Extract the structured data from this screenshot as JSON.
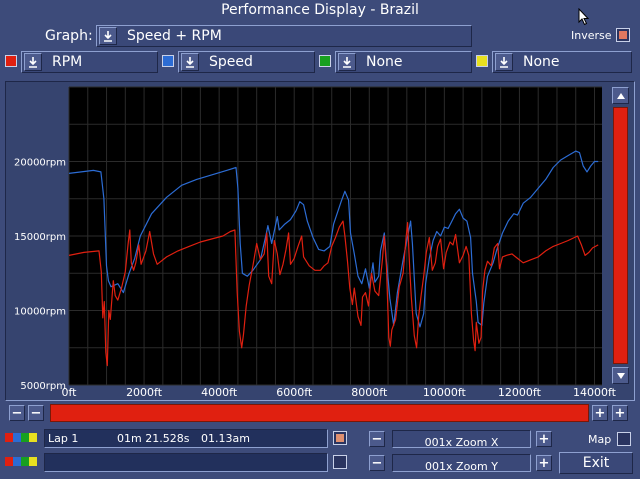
{
  "window": {
    "title": "Performance Display - Brazil"
  },
  "graph": {
    "label": "Graph:",
    "selected": "Speed + RPM"
  },
  "inverse": {
    "label": "Inverse"
  },
  "channels": [
    {
      "color": "#e02010",
      "name": "RPM"
    },
    {
      "color": "#2c6cd4",
      "name": "Speed"
    },
    {
      "color": "#18a020",
      "name": "None"
    },
    {
      "color": "#e8e020",
      "name": "None"
    }
  ],
  "icons": {
    "dropdown": "download-arrow-icon",
    "scroll_up": "up-arrow-icon",
    "scroll_down": "down-arrow-icon",
    "minus": "minus-icon",
    "plus": "plus-icon",
    "cursor": "mouse-pointer-icon"
  },
  "chart_data": {
    "type": "line",
    "xlabel": "",
    "ylabel": "",
    "xlim": [
      0,
      14200
    ],
    "ylim": [
      5000,
      25000
    ],
    "x_ticks": [
      {
        "v": 0,
        "label": "0ft"
      },
      {
        "v": 2000,
        "label": "2000ft"
      },
      {
        "v": 4000,
        "label": "4000ft"
      },
      {
        "v": 6000,
        "label": "6000ft"
      },
      {
        "v": 8000,
        "label": "8000ft"
      },
      {
        "v": 10000,
        "label": "10000ft"
      },
      {
        "v": 12000,
        "label": "12000ft"
      },
      {
        "v": 14000,
        "label": "14000ft"
      }
    ],
    "y_ticks": [
      {
        "v": 5000,
        "label": "5000rpm"
      },
      {
        "v": 10000,
        "label": "10000rpm"
      },
      {
        "v": 15000,
        "label": "15000rpm"
      },
      {
        "v": 20000,
        "label": "20000rpm"
      }
    ],
    "grid": true,
    "series": [
      {
        "color": "#2c6cd4",
        "points": [
          [
            0,
            19200
          ],
          [
            650,
            19400
          ],
          [
            850,
            19300
          ],
          [
            930,
            17500
          ],
          [
            1000,
            13000
          ],
          [
            1050,
            12000
          ],
          [
            1120,
            11600
          ],
          [
            1300,
            11800
          ],
          [
            1450,
            11200
          ],
          [
            1600,
            12500
          ],
          [
            1750,
            13500
          ],
          [
            1900,
            15000
          ],
          [
            2200,
            16500
          ],
          [
            2600,
            17600
          ],
          [
            3000,
            18400
          ],
          [
            3400,
            18800
          ],
          [
            3800,
            19100
          ],
          [
            4200,
            19400
          ],
          [
            4450,
            19600
          ],
          [
            4500,
            18200
          ],
          [
            4560,
            14500
          ],
          [
            4620,
            12500
          ],
          [
            4750,
            12300
          ],
          [
            4900,
            12700
          ],
          [
            5100,
            13400
          ],
          [
            5250,
            15100
          ],
          [
            5300,
            15700
          ],
          [
            5400,
            14500
          ],
          [
            5550,
            16300
          ],
          [
            5600,
            15400
          ],
          [
            5750,
            15800
          ],
          [
            5900,
            16100
          ],
          [
            6050,
            16700
          ],
          [
            6150,
            17300
          ],
          [
            6250,
            17100
          ],
          [
            6350,
            16000
          ],
          [
            6500,
            14900
          ],
          [
            6650,
            14100
          ],
          [
            6800,
            14000
          ],
          [
            6950,
            14300
          ],
          [
            7050,
            15800
          ],
          [
            7250,
            17300
          ],
          [
            7350,
            18000
          ],
          [
            7450,
            17400
          ],
          [
            7500,
            15200
          ],
          [
            7600,
            13800
          ],
          [
            7700,
            12300
          ],
          [
            7800,
            11800
          ],
          [
            7900,
            12800
          ],
          [
            8000,
            11500
          ],
          [
            8100,
            13200
          ],
          [
            8150,
            11900
          ],
          [
            8250,
            12300
          ],
          [
            8300,
            14000
          ],
          [
            8400,
            15200
          ],
          [
            8450,
            13500
          ],
          [
            8550,
            10800
          ],
          [
            8650,
            9000
          ],
          [
            8750,
            11200
          ],
          [
            8900,
            13400
          ],
          [
            9000,
            14700
          ],
          [
            9100,
            16000
          ],
          [
            9150,
            14500
          ],
          [
            9250,
            9800
          ],
          [
            9350,
            8900
          ],
          [
            9450,
            9800
          ],
          [
            9500,
            11800
          ],
          [
            9600,
            13500
          ],
          [
            9700,
            14700
          ],
          [
            9800,
            15300
          ],
          [
            9900,
            15000
          ],
          [
            10000,
            15600
          ],
          [
            10100,
            15500
          ],
          [
            10200,
            16000
          ],
          [
            10300,
            16500
          ],
          [
            10400,
            16800
          ],
          [
            10500,
            16200
          ],
          [
            10600,
            16000
          ],
          [
            10700,
            14900
          ],
          [
            10750,
            12500
          ],
          [
            10850,
            10600
          ],
          [
            10900,
            9200
          ],
          [
            11000,
            9000
          ],
          [
            11050,
            10500
          ],
          [
            11150,
            12300
          ],
          [
            11300,
            13200
          ],
          [
            11400,
            14100
          ],
          [
            11550,
            15200
          ],
          [
            11700,
            16000
          ],
          [
            11850,
            16500
          ],
          [
            11950,
            16400
          ],
          [
            12100,
            17200
          ],
          [
            12300,
            17600
          ],
          [
            12500,
            18200
          ],
          [
            12700,
            18800
          ],
          [
            12900,
            19600
          ],
          [
            13100,
            20100
          ],
          [
            13300,
            20400
          ],
          [
            13500,
            20700
          ],
          [
            13600,
            20600
          ],
          [
            13700,
            19700
          ],
          [
            13800,
            19300
          ],
          [
            13900,
            19700
          ],
          [
            14000,
            20000
          ],
          [
            14100,
            20000
          ]
        ]
      },
      {
        "color": "#e02010",
        "points": [
          [
            0,
            13700
          ],
          [
            400,
            13900
          ],
          [
            800,
            14000
          ],
          [
            860,
            12600
          ],
          [
            900,
            9500
          ],
          [
            940,
            10600
          ],
          [
            980,
            7200
          ],
          [
            1020,
            6300
          ],
          [
            1060,
            10000
          ],
          [
            1100,
            9400
          ],
          [
            1180,
            12000
          ],
          [
            1230,
            11000
          ],
          [
            1300,
            10700
          ],
          [
            1400,
            11500
          ],
          [
            1500,
            12600
          ],
          [
            1580,
            14600
          ],
          [
            1620,
            15400
          ],
          [
            1660,
            13200
          ],
          [
            1720,
            12700
          ],
          [
            1780,
            13200
          ],
          [
            1860,
            14400
          ],
          [
            1920,
            13100
          ],
          [
            2050,
            14000
          ],
          [
            2150,
            15300
          ],
          [
            2250,
            13800
          ],
          [
            2350,
            13100
          ],
          [
            2600,
            13600
          ],
          [
            2900,
            14000
          ],
          [
            3200,
            14300
          ],
          [
            3500,
            14600
          ],
          [
            3800,
            14800
          ],
          [
            4100,
            15000
          ],
          [
            4300,
            15300
          ],
          [
            4420,
            15400
          ],
          [
            4480,
            11200
          ],
          [
            4540,
            8600
          ],
          [
            4600,
            7500
          ],
          [
            4650,
            8400
          ],
          [
            4720,
            10300
          ],
          [
            4800,
            11700
          ],
          [
            4900,
            13000
          ],
          [
            5000,
            14500
          ],
          [
            5100,
            13400
          ],
          [
            5200,
            13800
          ],
          [
            5270,
            15200
          ],
          [
            5320,
            12300
          ],
          [
            5400,
            11800
          ],
          [
            5470,
            14700
          ],
          [
            5550,
            13800
          ],
          [
            5620,
            12400
          ],
          [
            5700,
            13100
          ],
          [
            5780,
            14100
          ],
          [
            5850,
            15200
          ],
          [
            5900,
            13100
          ],
          [
            6000,
            13500
          ],
          [
            6100,
            14300
          ],
          [
            6200,
            15000
          ],
          [
            6250,
            13600
          ],
          [
            6400,
            13000
          ],
          [
            6550,
            12700
          ],
          [
            6700,
            12700
          ],
          [
            6800,
            13000
          ],
          [
            6900,
            13200
          ],
          [
            7000,
            14300
          ],
          [
            7100,
            14900
          ],
          [
            7200,
            15600
          ],
          [
            7300,
            16000
          ],
          [
            7350,
            15000
          ],
          [
            7420,
            13300
          ],
          [
            7480,
            11500
          ],
          [
            7550,
            10400
          ],
          [
            7600,
            11500
          ],
          [
            7700,
            9600
          ],
          [
            7780,
            9000
          ],
          [
            7820,
            10900
          ],
          [
            7900,
            11200
          ],
          [
            7980,
            10300
          ],
          [
            8060,
            12500
          ],
          [
            8150,
            11300
          ],
          [
            8250,
            11000
          ],
          [
            8350,
            13400
          ],
          [
            8400,
            15000
          ],
          [
            8460,
            12900
          ],
          [
            8520,
            8200
          ],
          [
            8560,
            7600
          ],
          [
            8600,
            8700
          ],
          [
            8700,
            9400
          ],
          [
            8800,
            11600
          ],
          [
            8900,
            12500
          ],
          [
            8980,
            14900
          ],
          [
            9020,
            15900
          ],
          [
            9080,
            12700
          ],
          [
            9120,
            10900
          ],
          [
            9200,
            8300
          ],
          [
            9260,
            7500
          ],
          [
            9320,
            9700
          ],
          [
            9380,
            11000
          ],
          [
            9450,
            12300
          ],
          [
            9520,
            13900
          ],
          [
            9600,
            14900
          ],
          [
            9680,
            12700
          ],
          [
            9760,
            13200
          ],
          [
            9820,
            14300
          ],
          [
            9900,
            14800
          ],
          [
            9980,
            12800
          ],
          [
            10050,
            13900
          ],
          [
            10150,
            14600
          ],
          [
            10230,
            14400
          ],
          [
            10300,
            15100
          ],
          [
            10400,
            13200
          ],
          [
            10500,
            13700
          ],
          [
            10580,
            14300
          ],
          [
            10650,
            13700
          ],
          [
            10720,
            9800
          ],
          [
            10780,
            8000
          ],
          [
            10820,
            7300
          ],
          [
            10850,
            9200
          ],
          [
            10920,
            7800
          ],
          [
            10980,
            8200
          ],
          [
            11020,
            11300
          ],
          [
            11080,
            12700
          ],
          [
            11150,
            13300
          ],
          [
            11250,
            13000
          ],
          [
            11330,
            14200
          ],
          [
            11420,
            14500
          ],
          [
            11470,
            12800
          ],
          [
            11550,
            13600
          ],
          [
            11650,
            13700
          ],
          [
            11800,
            13800
          ],
          [
            11950,
            13500
          ],
          [
            12100,
            13200
          ],
          [
            12300,
            13400
          ],
          [
            12500,
            13600
          ],
          [
            12700,
            14000
          ],
          [
            12900,
            14300
          ],
          [
            13100,
            14500
          ],
          [
            13300,
            14700
          ],
          [
            13550,
            15000
          ],
          [
            13650,
            14400
          ],
          [
            13750,
            13700
          ],
          [
            13850,
            13900
          ],
          [
            13950,
            14200
          ],
          [
            14100,
            14400
          ]
        ]
      }
    ]
  },
  "bottom": {
    "lap_row1": {
      "lap": "Lap 1",
      "time": "01m 21.528s",
      "clock": "01.13am"
    },
    "lap_row2": {
      "lap": "",
      "time": "",
      "clock": ""
    },
    "zoom_x": "001x Zoom X",
    "zoom_y": "001x Zoom Y",
    "map_label": "Map",
    "exit_label": "Exit"
  }
}
